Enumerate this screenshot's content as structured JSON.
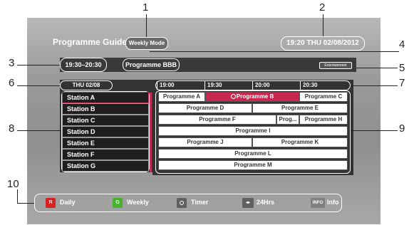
{
  "header": {
    "title": "Programme Guide",
    "mode": "Weekly Mode",
    "clock": "19:20  THU  02/08/2012"
  },
  "info": {
    "timeslot": "19:30–20:30",
    "programme": "Programme BBB",
    "genre": "Entertainment"
  },
  "guide": {
    "date": "THU  02/08",
    "times": [
      "19:00",
      "19:30",
      "20:00",
      "20:30"
    ],
    "stations": [
      "Station A",
      "Station B",
      "Station C",
      "Station D",
      "Station E",
      "Station F",
      "Station G"
    ],
    "rows": [
      [
        "Programme A",
        "Programme B",
        "Programme C"
      ],
      [
        "Programme D",
        "Programme E"
      ],
      [
        "Programme F",
        "Prog...",
        "Programme H"
      ],
      [
        "Programme I"
      ],
      [
        "Programme J",
        "Programme K"
      ],
      [
        "Programme L"
      ],
      [
        "Programme M"
      ]
    ]
  },
  "footer": {
    "keys": [
      {
        "key": "R",
        "label": "Daily",
        "color": "#d72020"
      },
      {
        "key": "G",
        "label": "Weekly",
        "color": "#4ab030"
      },
      {
        "key": "",
        "label": "Timer",
        "color": "#606060"
      },
      {
        "key": "",
        "label": "24Hrs",
        "color": "#606060"
      },
      {
        "key": "INFO",
        "label": "Info",
        "color": "#808080"
      }
    ]
  },
  "callouts": [
    "1",
    "2",
    "3",
    "4",
    "5",
    "6",
    "7",
    "8",
    "9",
    "10"
  ]
}
